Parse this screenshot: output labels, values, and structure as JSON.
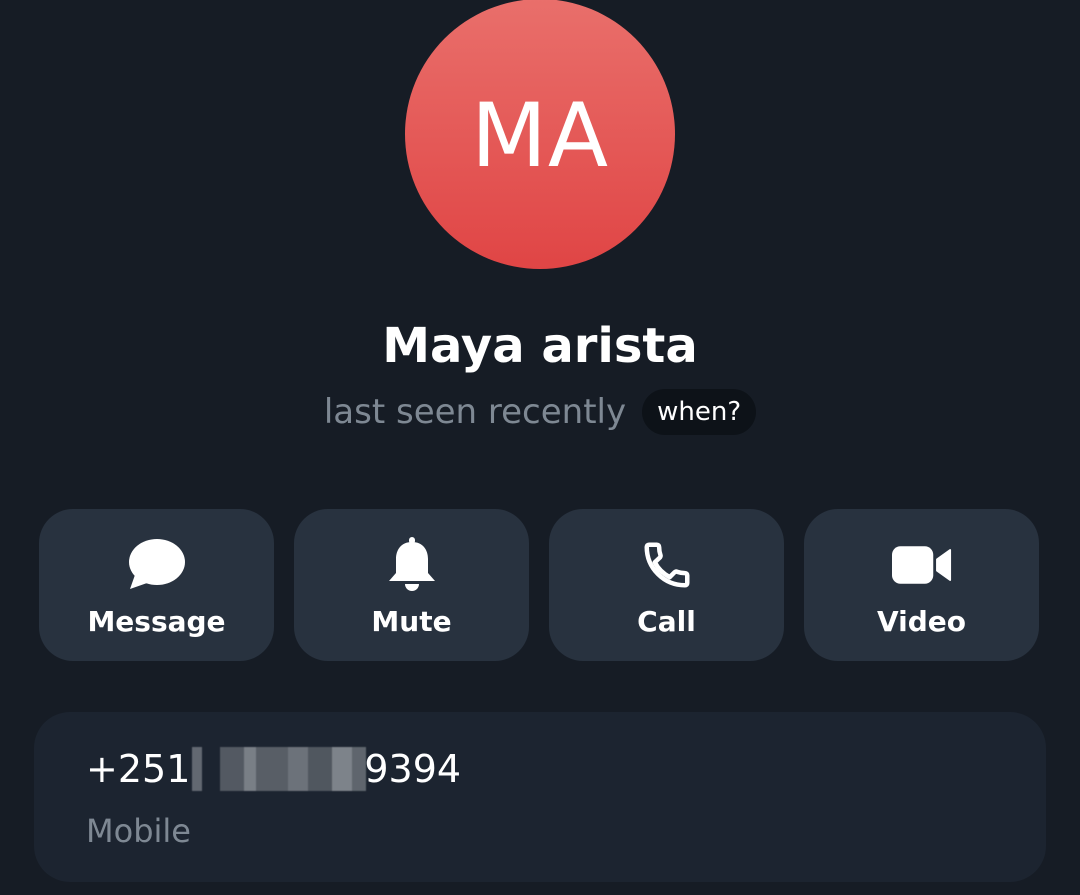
{
  "profile": {
    "initials": "MA",
    "name": "Maya arista",
    "status": "last seen recently",
    "when_chip": "when?",
    "avatar_color": "#e25a55"
  },
  "actions": [
    {
      "label": "Message",
      "icon": "message-bubble-icon"
    },
    {
      "label": "Mute",
      "icon": "bell-icon"
    },
    {
      "label": "Call",
      "icon": "phone-icon"
    },
    {
      "label": "Video",
      "icon": "video-camera-icon"
    }
  ],
  "contact": {
    "phone_prefix": "+251",
    "phone_suffix": "9394",
    "phone_label": "Mobile"
  }
}
